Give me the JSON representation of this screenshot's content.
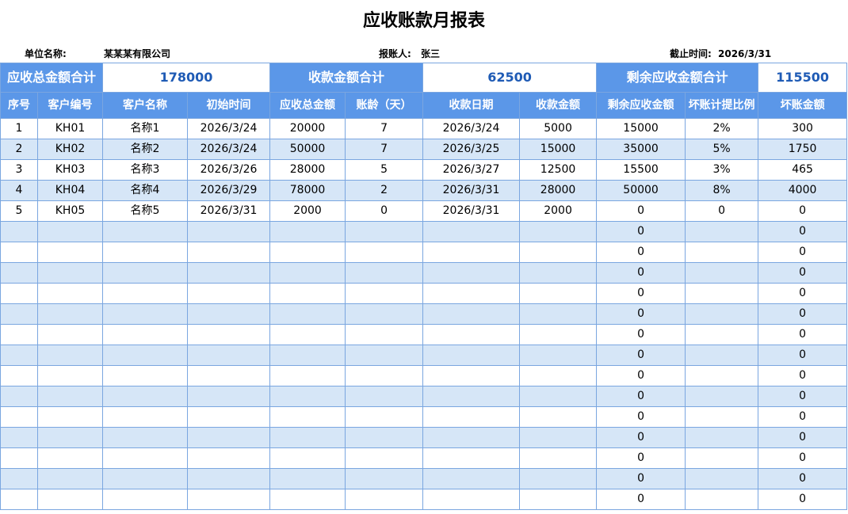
{
  "title": "应收账款月报表",
  "meta": {
    "company_label": "单位名称:",
    "company_value": "某某某有限公司",
    "reporter_label": "报账人:",
    "reporter_value": "张三",
    "deadline_label": "截止时间:",
    "deadline_value": "2026/3/31"
  },
  "summary": {
    "receivable_label": "应收总金额合计",
    "receivable_value": "178000",
    "collected_label": "收款金额合计",
    "collected_value": "62500",
    "remaining_label": "剩余应收金额合计",
    "remaining_value": "115500"
  },
  "columns": [
    "序号",
    "客户编号",
    "客户名称",
    "初始时间",
    "应收总金额",
    "账龄（天）",
    "收款日期",
    "收款金额",
    "剩余应收金额",
    "坏账计提比例",
    "坏账金额"
  ],
  "rows": [
    [
      "1",
      "KH01",
      "名称1",
      "2026/3/24",
      "20000",
      "7",
      "2026/3/24",
      "5000",
      "15000",
      "2%",
      "300"
    ],
    [
      "2",
      "KH02",
      "名称2",
      "2026/3/24",
      "50000",
      "7",
      "2026/3/25",
      "15000",
      "35000",
      "5%",
      "1750"
    ],
    [
      "3",
      "KH03",
      "名称3",
      "2026/3/26",
      "28000",
      "5",
      "2026/3/27",
      "12500",
      "15500",
      "3%",
      "465"
    ],
    [
      "4",
      "KH04",
      "名称4",
      "2026/3/29",
      "78000",
      "2",
      "2026/3/31",
      "28000",
      "50000",
      "8%",
      "4000"
    ],
    [
      "5",
      "KH05",
      "名称5",
      "2026/3/31",
      "2000",
      "0",
      "2026/3/31",
      "2000",
      "0",
      "0",
      "0"
    ],
    [
      "",
      "",
      "",
      "",
      "",
      "",
      "",
      "",
      "0",
      "",
      "0"
    ],
    [
      "",
      "",
      "",
      "",
      "",
      "",
      "",
      "",
      "0",
      "",
      "0"
    ],
    [
      "",
      "",
      "",
      "",
      "",
      "",
      "",
      "",
      "0",
      "",
      "0"
    ],
    [
      "",
      "",
      "",
      "",
      "",
      "",
      "",
      "",
      "0",
      "",
      "0"
    ],
    [
      "",
      "",
      "",
      "",
      "",
      "",
      "",
      "",
      "0",
      "",
      "0"
    ],
    [
      "",
      "",
      "",
      "",
      "",
      "",
      "",
      "",
      "0",
      "",
      "0"
    ],
    [
      "",
      "",
      "",
      "",
      "",
      "",
      "",
      "",
      "0",
      "",
      "0"
    ],
    [
      "",
      "",
      "",
      "",
      "",
      "",
      "",
      "",
      "0",
      "",
      "0"
    ],
    [
      "",
      "",
      "",
      "",
      "",
      "",
      "",
      "",
      "0",
      "",
      "0"
    ],
    [
      "",
      "",
      "",
      "",
      "",
      "",
      "",
      "",
      "0",
      "",
      "0"
    ],
    [
      "",
      "",
      "",
      "",
      "",
      "",
      "",
      "",
      "0",
      "",
      "0"
    ],
    [
      "",
      "",
      "",
      "",
      "",
      "",
      "",
      "",
      "0",
      "",
      "0"
    ],
    [
      "",
      "",
      "",
      "",
      "",
      "",
      "",
      "",
      "0",
      "",
      "0"
    ],
    [
      "",
      "",
      "",
      "",
      "",
      "",
      "",
      "",
      "0",
      "",
      "0"
    ]
  ]
}
